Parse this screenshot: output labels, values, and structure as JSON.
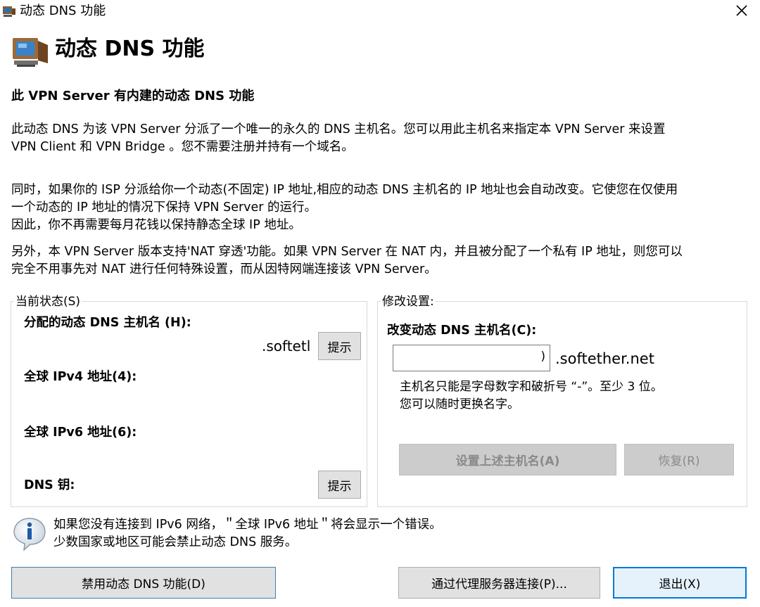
{
  "window": {
    "title": "动态 DNS 功能"
  },
  "header": {
    "title": "动态 DNS 功能"
  },
  "subtitle": "此 VPN Server 有内建的动态 DNS 功能",
  "paragraphs": {
    "p1": "此动态 DNS 为该 VPN Server 分派了一个唯一的永久的 DNS 主机名。您可以用此主机名来指定本 VPN Server 来设置\nVPN Client 和 VPN Bridge 。您不需要注册并持有一个域名。",
    "p2": "同时，如果你的 ISP 分派给你一个动态(不固定) IP 地址,相应的动态 DNS 主机名的 IP 地址也会自动改变。它使您在仅使用\n一个动态的 IP 地址的情况下保持 VPN Server 的运行。\n因此，你不再需要每月花钱以保持静态全球 IP 地址。",
    "p3": "另外，本 VPN Server 版本支持'NAT 穿透'功能。如果 VPN Server 在 NAT 内，并且被分配了一个私有 IP 地址，则您可以\n完全不用事先对 NAT 进行任何特殊设置，而从因特网端连接该 VPN Server。"
  },
  "current_status": {
    "group_label": "当前状态(S)",
    "hostname_label": "分配的动态 DNS 主机名 (H):",
    "hostname_value": ".softetl",
    "hint_button_1": "提示",
    "ipv4_label": "全球 IPv4 地址(4):",
    "ipv6_label": "全球 IPv6 地址(6):",
    "dns_key_label": "DNS 钥:",
    "hint_button_2": "提示"
  },
  "modify": {
    "group_label": "修改设置:",
    "change_label": "改变动态 DNS 主机名(C):",
    "input_value": ")",
    "suffix": ".softether.net",
    "hint": "主机名只能是字母数字和破折号 “-”。至少 3 位。\n您可以随时更换名字。",
    "set_button": "设置上述主机名(A)",
    "restore_button": "恢复(R)"
  },
  "info": {
    "text": "如果您没有连接到 IPv6 网络，＂全球 IPv6 地址＂将会显示一个错误。\n少数国家或地区可能会禁止动态 DNS 服务。"
  },
  "footer": {
    "disable_button": "禁用动态 DNS 功能(D)",
    "proxy_button": "通过代理服务器连接(P)...",
    "exit_button": "退出(X)"
  },
  "colors": {
    "default_button_border": "#0078d7",
    "disabled_button_bg": "#cccccc"
  },
  "icons": {
    "titlebar": "computer-icon",
    "header": "computer-icon",
    "close": "close-icon",
    "info": "info-icon"
  }
}
